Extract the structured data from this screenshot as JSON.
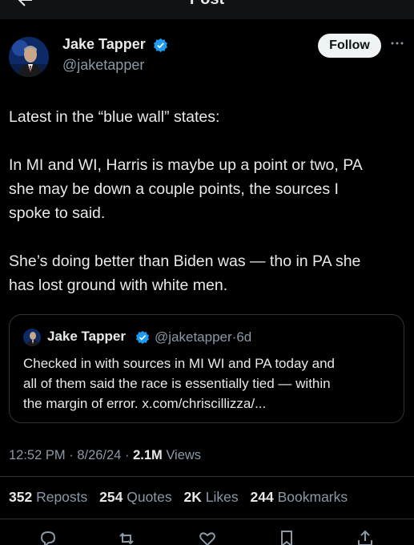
{
  "header": {
    "title": "Post",
    "back_icon": "arrow-left-icon"
  },
  "author": {
    "name": "Jake Tapper",
    "handle": "@jaketapper",
    "verified_icon": "verified-badge-icon",
    "follow_label": "Follow",
    "more_icon": "more-horizontal-icon"
  },
  "tweet": {
    "lines": [
      "Latest in the “blue wall” states:",
      "",
      "In MI and WI, Harris is maybe up a point or two, PA",
      "she may be down a couple points, the sources I",
      "spoke to said.",
      "",
      "She’s doing better than Biden was — tho in PA she",
      "has lost ground with white men."
    ]
  },
  "quote": {
    "name": "Jake Tapper",
    "handle": "@jaketapper",
    "separator": "·",
    "age": "6d",
    "lines": [
      "Checked in with sources in MI WI and PA today and",
      "all of them said the race is essentially tied — within",
      "the margin of error. x.com/chriscillizza/..."
    ]
  },
  "meta": {
    "time": "12:52 PM",
    "separator": "·",
    "date": "8/26/24",
    "views_count": "2.1M",
    "views_label": "Views"
  },
  "stats": {
    "reposts_count": "352",
    "reposts_label": "Reposts",
    "quotes_count": "254",
    "quotes_label": "Quotes",
    "likes_count": "2K",
    "likes_label": "Likes",
    "bookmarks_count": "244",
    "bookmarks_label": "Bookmarks"
  },
  "actions": [
    "reply-icon",
    "repost-icon",
    "like-icon",
    "bookmark-icon",
    "share-icon"
  ],
  "colors": {
    "background": "#000000",
    "text": "#e7e9ea",
    "secondary": "#8b98a5",
    "verified": "#1d9bf0",
    "follow_bg": "#eff3f4"
  }
}
